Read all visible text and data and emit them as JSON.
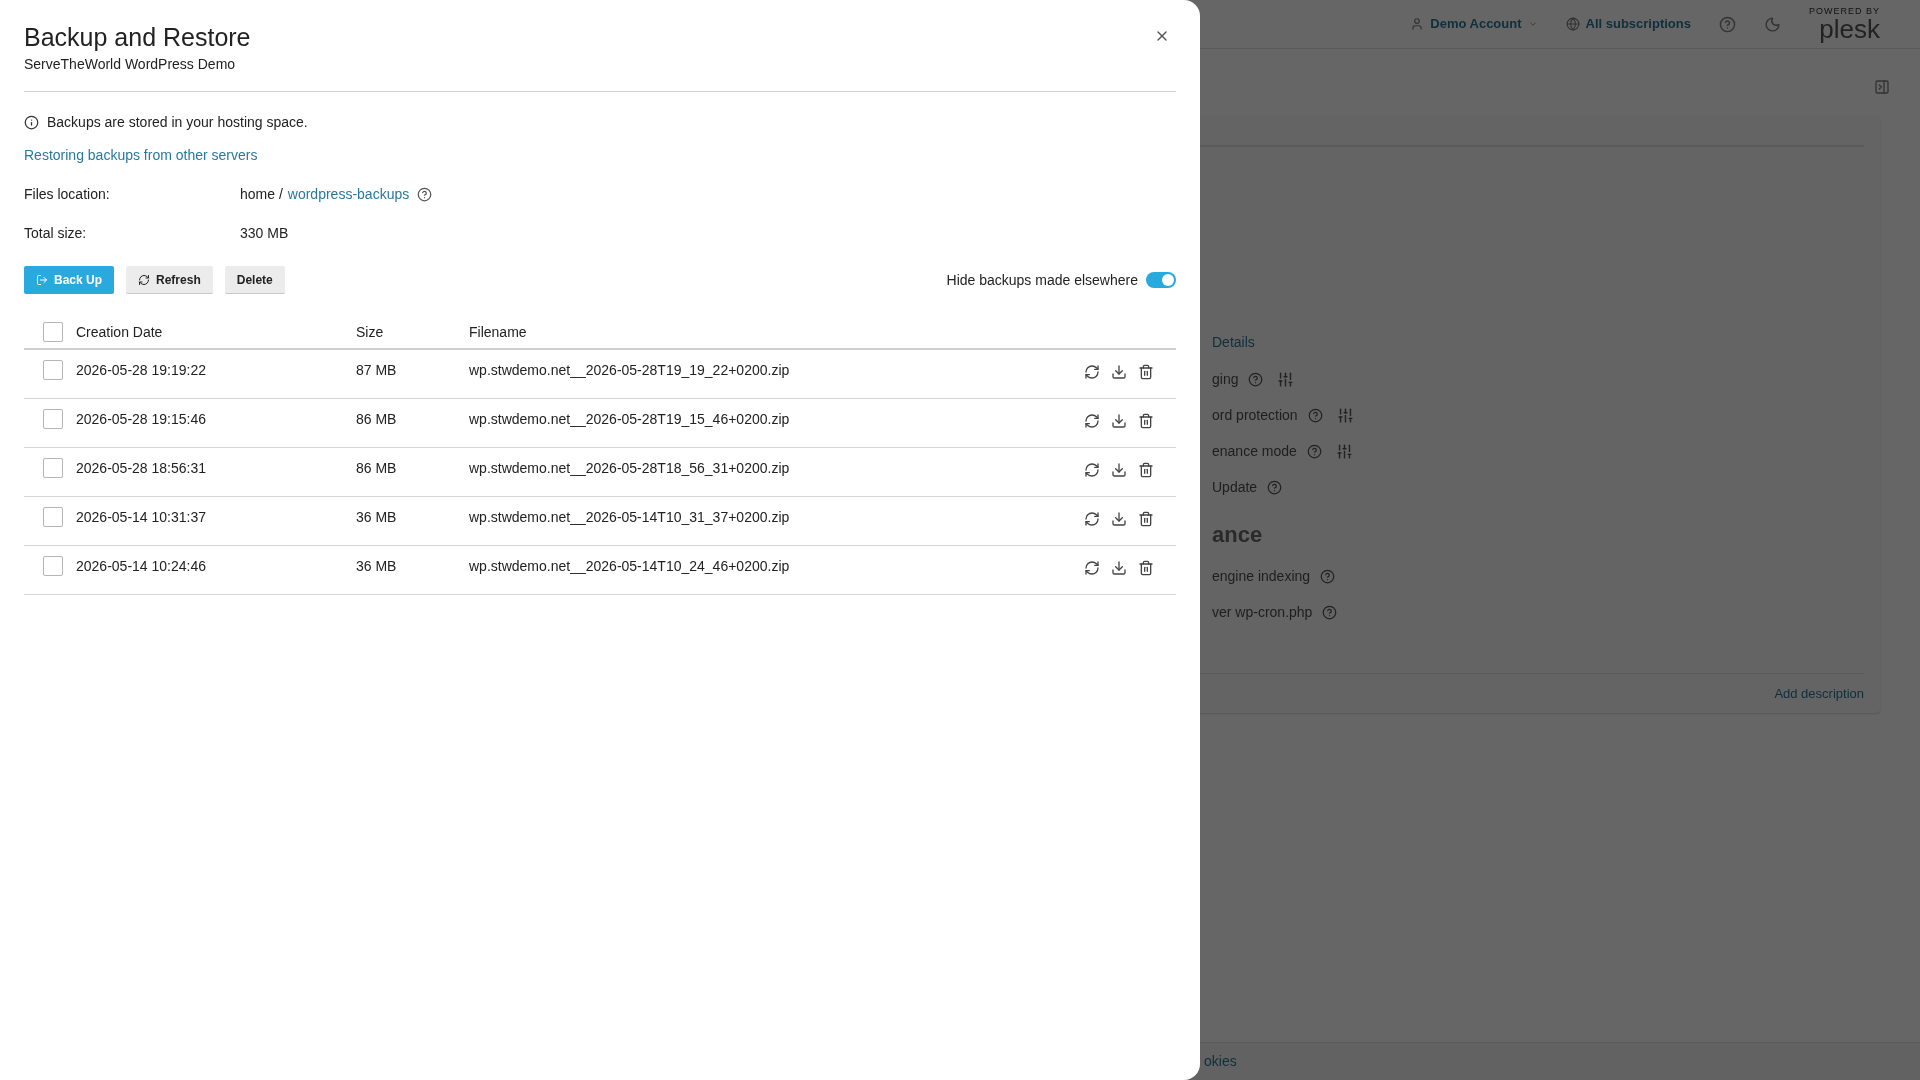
{
  "drawer": {
    "title": "Backup and Restore",
    "subtitle": "ServeTheWorld WordPress Demo",
    "info": "Backups are stored in your hosting space.",
    "link": "Restoring backups from other servers",
    "details": [
      {
        "label": "Files location:",
        "value": "home /",
        "link": "wordpress-backups",
        "help": true
      },
      {
        "label": "Total size:",
        "value": "330 MB",
        "help": false
      }
    ],
    "buttons": [
      {
        "label": "Back Up",
        "kind": "primary"
      },
      {
        "label": "Refresh",
        "kind": "refresh"
      },
      {
        "label": "Delete",
        "kind": "plain"
      }
    ],
    "toggle": {
      "label": "Hide backups made elsewhere",
      "on": true
    },
    "table": {
      "select_all": {
        "checked": false
      },
      "columns": [
        "Creation Date",
        "Size",
        "Filename"
      ],
      "rows": [
        {
          "date": "2026-05-28 19:19:22",
          "size": "87 MB",
          "filename": "wp.stwdemo.net__2026-05-28T19_19_22+0200.zip",
          "checked": false
        },
        {
          "date": "2026-05-28 19:15:46",
          "size": "86 MB",
          "filename": "wp.stwdemo.net__2026-05-28T19_15_46+0200.zip",
          "checked": false
        },
        {
          "date": "2026-05-28 18:56:31",
          "size": "86 MB",
          "filename": "wp.stwdemo.net__2026-05-28T18_56_31+0200.zip",
          "checked": false
        },
        {
          "date": "2026-05-14 10:31:37",
          "size": "36 MB",
          "filename": "wp.stwdemo.net__2026-05-14T10_31_37+0200.zip",
          "checked": false
        },
        {
          "date": "2026-05-14 10:24:46",
          "size": "36 MB",
          "filename": "wp.stwdemo.net__2026-05-14T10_24_46+0200.zip",
          "checked": false
        }
      ]
    }
  },
  "background": {
    "header": {
      "account": "Demo Account",
      "subscriptions": "All subscriptions",
      "logo_small": "POWERED BY",
      "logo": "plesk"
    },
    "items": [
      {
        "kind": "link",
        "text": "Details"
      },
      {
        "kind": "setting",
        "text": "ging",
        "help": true,
        "settings": true
      },
      {
        "kind": "setting",
        "text": "ord protection",
        "help": true,
        "settings": true
      },
      {
        "kind": "setting",
        "text": "enance mode",
        "help": true,
        "settings": true
      },
      {
        "kind": "setting",
        "text": "Update",
        "help": true,
        "settings": false
      },
      {
        "kind": "heading",
        "text": "ance"
      },
      {
        "kind": "setting",
        "text": "engine indexing",
        "help": true,
        "settings": false
      },
      {
        "kind": "setting",
        "text": "ver wp-cron.php",
        "help": true,
        "settings": false
      }
    ],
    "add_description": "Add description",
    "footer": "okies"
  }
}
